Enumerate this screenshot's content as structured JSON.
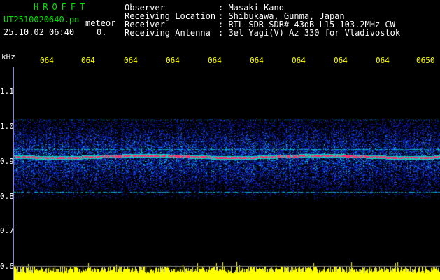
{
  "header": {
    "brand": "HROFFT",
    "filename": "UT2510020640.pn",
    "mode": "meteor",
    "datetime": "25.10.02 06:40",
    "count": "0.",
    "fields": [
      {
        "label": "Observer",
        "value": ": Masaki Kano"
      },
      {
        "label": "Receiving Location",
        "value": ": Shibukawa, Gunma, Japan"
      },
      {
        "label": "Receiver",
        "value": ": RTL-SDR SDR# 43dB L15 103.2MHz CW"
      },
      {
        "label": "Receiving Antenna",
        "value": ": 3el Yagi(V) Az 330 for Vladivostok"
      }
    ]
  },
  "colors": {
    "background": "#000000",
    "header_green": "#00e400",
    "time_tick_yellow": "#ffff00",
    "signal_red": "#ff2060",
    "noise_blue": "#1830c0",
    "level_yellow": "#ffff00"
  },
  "axes": {
    "y_unit": "kHz",
    "y_ticks": [
      "1.1",
      "1.0",
      "0.9",
      "0.8",
      "0.7",
      "0.6"
    ],
    "x_ticks": [
      "064",
      "064",
      "064",
      "064",
      "064",
      "064",
      "064",
      "064",
      "064",
      "0650"
    ]
  },
  "spectrogram": {
    "band_top_khz": 1.02,
    "band_bottom_khz": 0.78,
    "carrier_khz": 0.915,
    "weak_lines_khz": [
      1.02,
      0.935,
      0.815
    ]
  }
}
